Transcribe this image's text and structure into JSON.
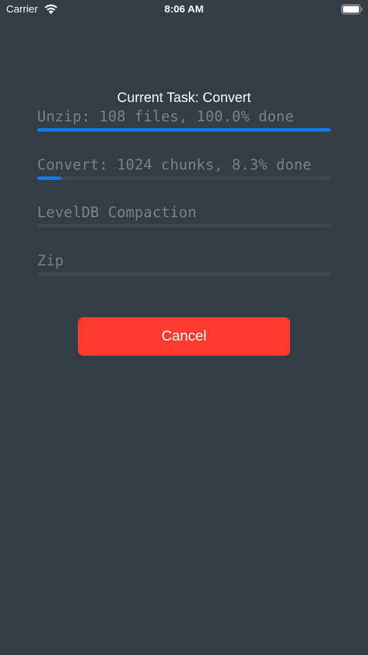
{
  "status_bar": {
    "carrier": "Carrier",
    "time": "8:06 AM",
    "wifi_icon": "wifi-icon",
    "battery_icon": "battery-icon"
  },
  "task": {
    "title": "Current Task: Convert"
  },
  "steps": [
    {
      "label": "Unzip: 108 files, 100.0% done",
      "progress": 1.0
    },
    {
      "label": "Convert: 1024 chunks, 8.3% done",
      "progress": 0.083
    },
    {
      "label": "LevelDB Compaction",
      "progress": 0.0
    },
    {
      "label": "Zip",
      "progress": 0.0
    }
  ],
  "actions": {
    "cancel_label": "Cancel"
  },
  "colors": {
    "background": "#353d44",
    "progress_fill": "#0a7cf5",
    "progress_track": "#414a51",
    "cancel": "#ff3b30",
    "step_text": "#7d8185"
  }
}
